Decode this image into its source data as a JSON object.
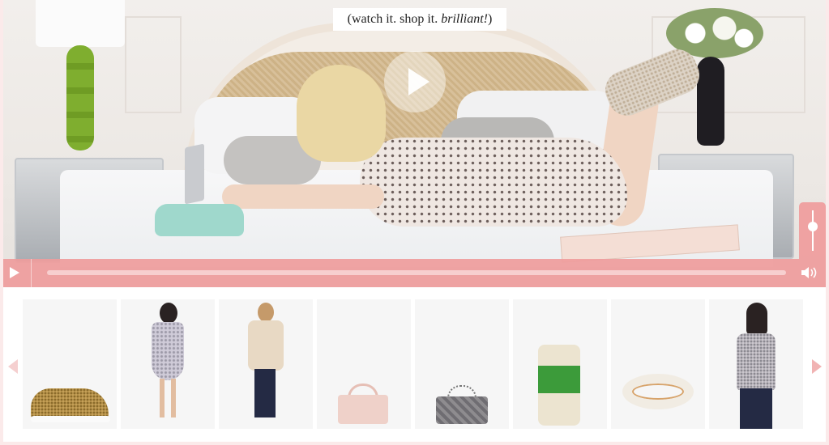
{
  "video": {
    "tagline_prefix": "(watch it. shop it. ",
    "tagline_emphasis": "brilliant!",
    "tagline_suffix": ")",
    "big_play_icon": "play-icon",
    "controls": {
      "play_icon": "play-icon",
      "volume_icon": "speaker-icon",
      "progress": 0,
      "volume": 0.55,
      "accent": "#ef9c9c"
    }
  },
  "carousel": {
    "prev_icon": "chevron-left-icon",
    "next_icon": "chevron-right-icon",
    "products": [
      {
        "name": "glitter sneaker"
      },
      {
        "name": "sequin dress"
      },
      {
        "name": "camel coat"
      },
      {
        "name": "pink bow handbag"
      },
      {
        "name": "silver quilted bag"
      },
      {
        "name": "green band phone case"
      },
      {
        "name": "enamel bangle"
      },
      {
        "name": "sequin top"
      }
    ]
  }
}
